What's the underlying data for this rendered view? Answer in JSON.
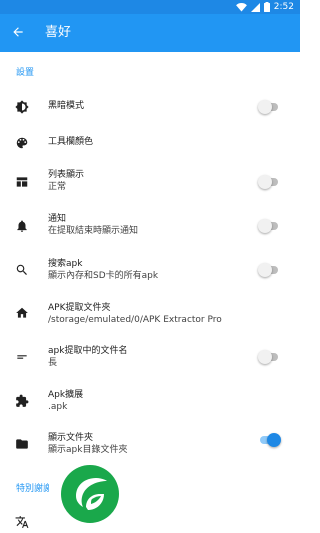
{
  "status_bar": {
    "time": "2:52"
  },
  "app_bar": {
    "title": "喜好"
  },
  "sections": {
    "settings": "設置",
    "thanks": "特別謝謝"
  },
  "settings": [
    {
      "title": "黑暗模式",
      "subtitle": "",
      "icon": "theme-icon",
      "switch": "off"
    },
    {
      "title": "工具欄顏色",
      "subtitle": "",
      "icon": "palette-icon",
      "switch": "none"
    },
    {
      "title": "列表顯示",
      "subtitle": "正常",
      "icon": "view-list-icon",
      "switch": "off"
    },
    {
      "title": "通知",
      "subtitle": "在提取結束時顯示通知",
      "icon": "bell-icon",
      "switch": "off"
    },
    {
      "title": "搜索apk",
      "subtitle": "顯示內存和SD卡的所有apk",
      "icon": "search-icon",
      "switch": "off"
    },
    {
      "title": "APK提取文件夾",
      "subtitle": "/storage/emulated/0/APK Extractor Pro",
      "icon": "home-icon",
      "switch": "none"
    },
    {
      "title": "apk提取中的文件名",
      "subtitle": "長",
      "icon": "short-text-icon",
      "switch": "off"
    },
    {
      "title": "Apk擴展",
      "subtitle": ".apk",
      "icon": "extension-icon",
      "switch": "none"
    },
    {
      "title": "顯示文件夾",
      "subtitle": "顯示apk目錄文件夾",
      "icon": "folder-icon",
      "switch": "on"
    }
  ],
  "thanks_items": [
    {
      "icon": "translate-icon"
    }
  ],
  "colors": {
    "primary": "#2196f3",
    "status_bar": "#1e88e5",
    "switch_on": "#1e88e5",
    "watermark_green": "#1aa84b"
  }
}
